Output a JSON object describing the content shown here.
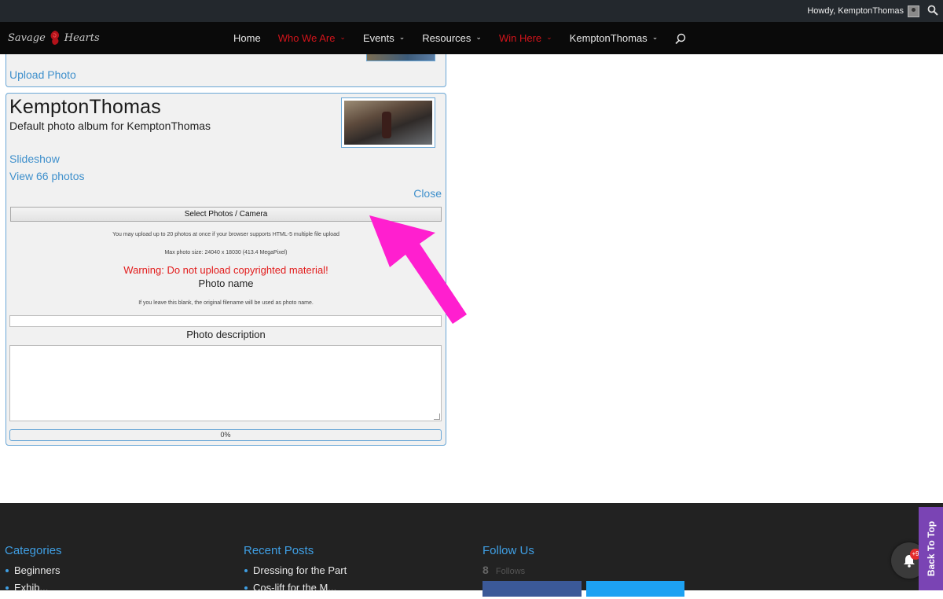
{
  "adminbar": {
    "greeting": "Howdy, KemptonThomas"
  },
  "nav": {
    "logo_text_left": "Savage",
    "logo_text_right": "Hearts",
    "items": [
      {
        "label": "Home",
        "has_dropdown": false,
        "color": "#e8e8e8"
      },
      {
        "label": "Who We Are",
        "has_dropdown": true,
        "color": "#d3141b"
      },
      {
        "label": "Events",
        "has_dropdown": true,
        "color": "#e8e8e8"
      },
      {
        "label": "Resources",
        "has_dropdown": true,
        "color": "#e8e8e8"
      },
      {
        "label": "Win Here",
        "has_dropdown": true,
        "color": "#d3141b"
      },
      {
        "label": "KemptonThomas",
        "has_dropdown": true,
        "color": "#e8e8e8"
      }
    ]
  },
  "previous_album": {
    "upload_link": "Upload Photo"
  },
  "album": {
    "title": "KemptonThomas",
    "subtitle": "Default photo album for KemptonThomas",
    "slideshow_link": "Slideshow",
    "view_photos_link": "View 66 photos",
    "close_link": "Close"
  },
  "uploader": {
    "select_button": "Select Photos / Camera",
    "multi_note": "You may upload up to 20 photos at once if your browser supports HTML-5 multiple file upload",
    "max_size_note": "Max photo size: 24040 x 18030 (413.4 MegaPixel)",
    "warning": "Warning: Do not upload copyrighted material!",
    "photo_name_label": "Photo name",
    "photo_name_note": "If you leave this blank, the original filename will be used as photo name.",
    "photo_name_value": "",
    "photo_description_label": "Photo description",
    "photo_description_value": "",
    "progress_text": "0%",
    "progress_fraction": 0
  },
  "footer": {
    "categories": {
      "heading": "Categories",
      "items": [
        "Beginners",
        "Exhib..."
      ]
    },
    "recent_posts": {
      "heading": "Recent Posts",
      "items": [
        "Dressing for the Part",
        "Cos-lift for the M..."
      ]
    },
    "follow_us": {
      "heading": "Follow Us",
      "count": "8",
      "count_label": "Follows"
    }
  },
  "notifications": {
    "badge": "+9"
  },
  "back_to_top": "Back To Top",
  "colors": {
    "accent": "#3f90cc",
    "nav_red": "#d3141b",
    "arrow": "#ff1fcf",
    "back_to_top": "#7a44b4"
  }
}
